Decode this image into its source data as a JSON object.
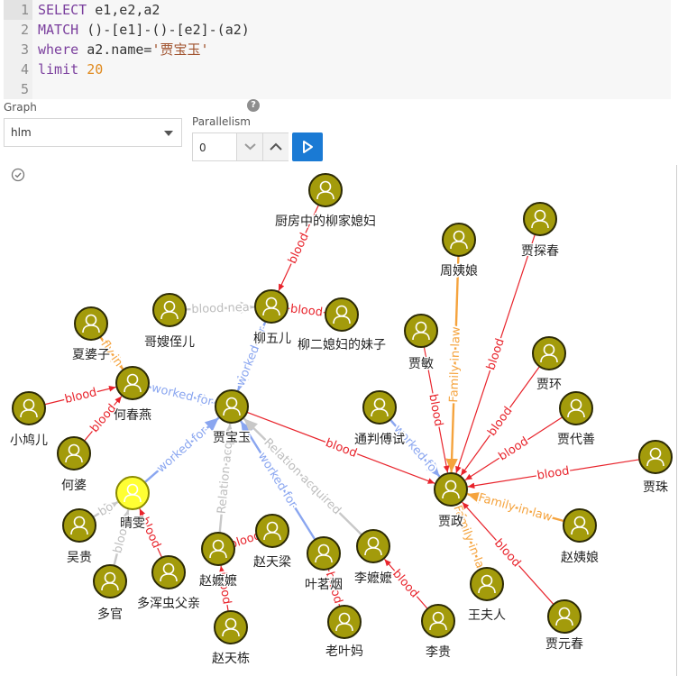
{
  "editor": {
    "lines": [
      {
        "num": "1",
        "tokens": [
          {
            "t": "SELECT ",
            "c": "kw"
          },
          {
            "t": "e1,e2,a2",
            "c": "pl"
          }
        ]
      },
      {
        "num": "2",
        "tokens": [
          {
            "t": "MATCH ",
            "c": "kw"
          },
          {
            "t": "()-[e1]-()-[e2]-(a2)",
            "c": "pl"
          }
        ]
      },
      {
        "num": "3",
        "tokens": [
          {
            "t": "where ",
            "c": "kw"
          },
          {
            "t": "a2.name=",
            "c": "pl"
          },
          {
            "t": "'贾宝玉'",
            "c": "str"
          }
        ]
      },
      {
        "num": "4",
        "tokens": [
          {
            "t": "limit ",
            "c": "kw"
          },
          {
            "t": "20",
            "c": "num"
          }
        ]
      },
      {
        "num": "5",
        "tokens": []
      }
    ]
  },
  "controls": {
    "graph_label": "Graph",
    "graph_value": "hlm",
    "parallelism_label": "Parallelism",
    "parallelism_value": "0",
    "help_glyph": "?"
  },
  "colors": {
    "node_fill": "#a39b0b",
    "node_highlight": "#ffff33",
    "edge_blood": "#e8232b",
    "edge_worked_for": "#8aa6f0",
    "edge_family": "#f5a33d",
    "edge_relation": "#c8c8c8",
    "run_button": "#1a7ad4"
  },
  "graph": {
    "nodes": [
      {
        "id": "liujia",
        "label": "厨房中的柳家媳妇"
      },
      {
        "id": "liuwu",
        "label": "柳五儿"
      },
      {
        "id": "gesao",
        "label": "哥嫂侄儿"
      },
      {
        "id": "liuer",
        "label": "柳二媳妇的妹子"
      },
      {
        "id": "xiapo",
        "label": "夏婆子"
      },
      {
        "id": "hechun",
        "label": "何春燕"
      },
      {
        "id": "xiaojiu",
        "label": "小鸠儿"
      },
      {
        "id": "hepo",
        "label": "何婆"
      },
      {
        "id": "baoyu",
        "label": "贾宝玉"
      },
      {
        "id": "qingwen",
        "label": "晴雯"
      },
      {
        "id": "wugui",
        "label": "吴贵"
      },
      {
        "id": "duoguan",
        "label": "多官"
      },
      {
        "id": "duohun",
        "label": "多浑虫父亲"
      },
      {
        "id": "zhaomo",
        "label": "赵嬷嬷"
      },
      {
        "id": "zhaotl",
        "label": "赵天梁"
      },
      {
        "id": "zhaotd",
        "label": "赵天栋"
      },
      {
        "id": "yeming",
        "label": "叶茗烟"
      },
      {
        "id": "laoye",
        "label": "老叶妈"
      },
      {
        "id": "limo",
        "label": "李嬷嬷"
      },
      {
        "id": "ligui",
        "label": "李贵"
      },
      {
        "id": "tongpan",
        "label": "通判傅试"
      },
      {
        "id": "zhouyi",
        "label": "周姨娘"
      },
      {
        "id": "jiamin",
        "label": "贾敏"
      },
      {
        "id": "tanchun",
        "label": "贾探春"
      },
      {
        "id": "jiahuan",
        "label": "贾环"
      },
      {
        "id": "daishan",
        "label": "贾代善"
      },
      {
        "id": "jiazhu",
        "label": "贾珠"
      },
      {
        "id": "jiazheng",
        "label": "贾政"
      },
      {
        "id": "zhaoyi",
        "label": "赵姨娘"
      },
      {
        "id": "wangfr",
        "label": "王夫人"
      },
      {
        "id": "yuanchun",
        "label": "贾元春"
      }
    ],
    "edges": [
      {
        "from": "liujia",
        "to": "liuwu",
        "type": "blood",
        "label": "blood"
      },
      {
        "from": "gesao",
        "to": "liuwu",
        "type": "relation",
        "label": "blood_nea"
      },
      {
        "from": "liuer",
        "to": "liuwu",
        "type": "blood",
        "label": "blood"
      },
      {
        "from": "liuwu",
        "to": "baoyu",
        "type": "worked_for",
        "label": "worked_for"
      },
      {
        "from": "xiapo",
        "to": "hechun",
        "type": "family",
        "label": "fly_in"
      },
      {
        "from": "xiaojiu",
        "to": "hechun",
        "type": "blood",
        "label": "blood"
      },
      {
        "from": "hepo",
        "to": "hechun",
        "type": "blood",
        "label": "blood"
      },
      {
        "from": "hechun",
        "to": "baoyu",
        "type": "worked_for",
        "label": "worked_for"
      },
      {
        "from": "qingwen",
        "to": "baoyu",
        "type": "worked_for",
        "label": "worked_for"
      },
      {
        "from": "wugui",
        "to": "qingwen",
        "type": "relation",
        "label": "bo"
      },
      {
        "from": "duoguan",
        "to": "qingwen",
        "type": "relation",
        "label": "blood"
      },
      {
        "from": "duohun",
        "to": "qingwen",
        "type": "blood",
        "label": "blood"
      },
      {
        "from": "zhaomo",
        "to": "baoyu",
        "type": "relation",
        "label": "Relation_acq"
      },
      {
        "from": "zhaotl",
        "to": "zhaomo",
        "type": "blood",
        "label": "blood"
      },
      {
        "from": "zhaotd",
        "to": "zhaomo",
        "type": "blood",
        "label": "blood"
      },
      {
        "from": "yeming",
        "to": "baoyu",
        "type": "worked_for",
        "label": "worked_for"
      },
      {
        "from": "laoye",
        "to": "yeming",
        "type": "blood",
        "label": "blood"
      },
      {
        "from": "limo",
        "to": "baoyu",
        "type": "relation",
        "label": "Relation_acquired"
      },
      {
        "from": "ligui",
        "to": "limo",
        "type": "blood",
        "label": "blood"
      },
      {
        "from": "baoyu",
        "to": "jiazheng",
        "type": "blood",
        "label": "blood"
      },
      {
        "from": "tongpan",
        "to": "jiazheng",
        "type": "worked_for",
        "label": "worked_fo"
      },
      {
        "from": "zhouyi",
        "to": "jiazheng",
        "type": "family",
        "label": "Family_in_law"
      },
      {
        "from": "jiamin",
        "to": "jiazheng",
        "type": "blood",
        "label": "blood"
      },
      {
        "from": "tanchun",
        "to": "jiazheng",
        "type": "blood",
        "label": "blood"
      },
      {
        "from": "jiahuan",
        "to": "jiazheng",
        "type": "blood",
        "label": "blood"
      },
      {
        "from": "daishan",
        "to": "jiazheng",
        "type": "blood",
        "label": "blood"
      },
      {
        "from": "jiazhu",
        "to": "jiazheng",
        "type": "blood",
        "label": "blood"
      },
      {
        "from": "zhaoyi",
        "to": "jiazheng",
        "type": "family",
        "label": "Family_in_law"
      },
      {
        "from": "wangfr",
        "to": "jiazheng",
        "type": "family",
        "label": "Family_in_la"
      },
      {
        "from": "yuanchun",
        "to": "jiazheng",
        "type": "blood",
        "label": "blood"
      }
    ],
    "highlighted": "qingwen"
  }
}
